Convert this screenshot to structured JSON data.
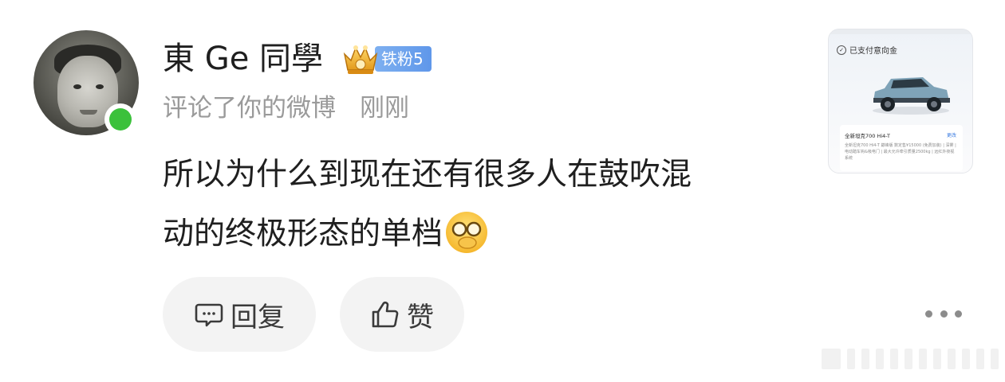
{
  "user": {
    "name": "東 Ge 同學",
    "badge_label": "铁粉5",
    "online": true
  },
  "meta": {
    "action": "评论了你的微博",
    "time": "刚刚"
  },
  "comment": {
    "line1": "所以为什么到现在还有很多人在鼓吹混",
    "line2": "动的终极形态的单档",
    "emoji": "face-with-glasses-covering-mouth-emoji"
  },
  "actions": {
    "reply_label": "回复",
    "like_label": "赞"
  },
  "thumbnail": {
    "paid_text": "已支付意向金",
    "card_title": "全新坦克700 Hi4-T",
    "card_change": "更改",
    "card_details": "全新坦克700 Hi4-T  巅峰版  数定售¥15000  (免费加装)  | 深雾 | 电动踏车钩&吸电门 | 最大允许牵引质量2500kg | 远红外夜视系统"
  },
  "colors": {
    "online": "#3bc13b",
    "badge_bg": "#6aa1ec",
    "meta_text": "#9a9a9a",
    "button_bg": "#f3f3f3"
  }
}
